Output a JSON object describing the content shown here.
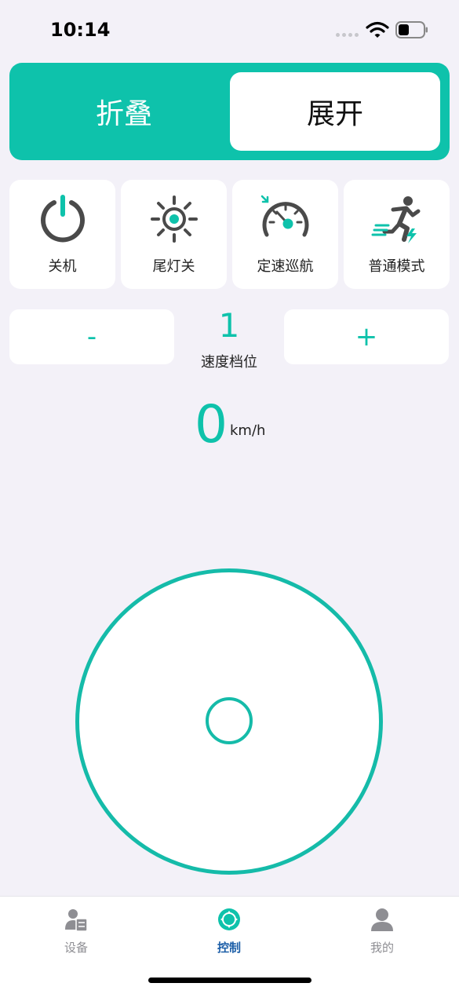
{
  "status_bar": {
    "time": "10:14"
  },
  "mode_toggle": {
    "fold_label": "折叠",
    "unfold_label": "展开",
    "selected": "展开"
  },
  "functions": [
    {
      "label": "关机",
      "icon": "power-icon"
    },
    {
      "label": "尾灯关",
      "icon": "sun-icon"
    },
    {
      "label": "定速巡航",
      "icon": "speedometer-icon"
    },
    {
      "label": "普通模式",
      "icon": "running-person-icon"
    }
  ],
  "speed_gear": {
    "minus_label": "-",
    "plus_label": "+",
    "value": "1",
    "label": "速度档位"
  },
  "speed": {
    "value": "0",
    "unit": "km/h"
  },
  "tab_bar": {
    "items": [
      {
        "label": "设备",
        "icon": "device-icon",
        "active": false
      },
      {
        "label": "控制",
        "icon": "control-icon",
        "active": true
      },
      {
        "label": "我的",
        "icon": "profile-icon",
        "active": false
      }
    ]
  },
  "colors": {
    "accent": "#0ec2ab",
    "active_tab": "#1d5fa8",
    "background": "#f3f1f8",
    "icon_dark": "#4a4a4a"
  }
}
